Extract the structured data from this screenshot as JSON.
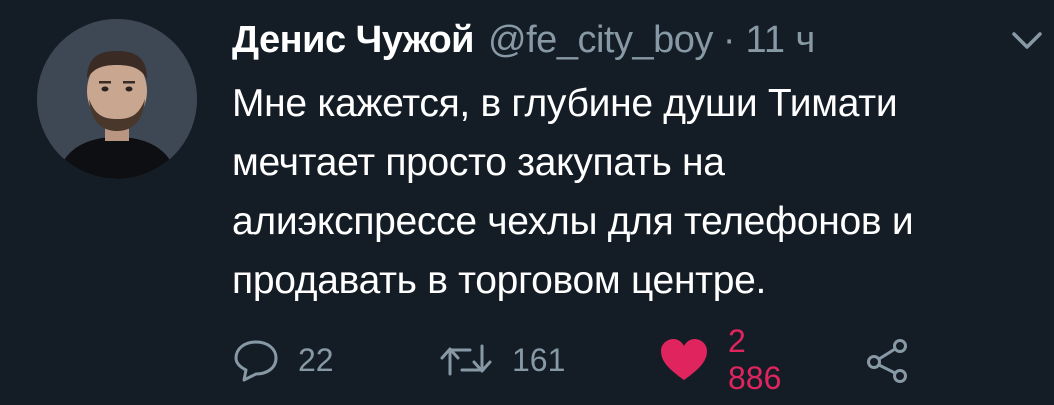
{
  "user": {
    "name": "Денис Чужой",
    "handle": "@fe_city_boy",
    "separator": "·",
    "time": "11 ч"
  },
  "tweet": {
    "lines": [
      "Мне кажется, в глубине души Тимати",
      "мечтает просто закупать на",
      "алиэкспрессе чехлы для телефонов и",
      "продавать в торговом центре."
    ]
  },
  "actions": {
    "reply": {
      "icon": "reply-icon",
      "count": "22"
    },
    "retweet": {
      "icon": "retweet-icon",
      "count": "161"
    },
    "like": {
      "icon": "heart-icon",
      "count": "2 886",
      "liked": true
    },
    "share": {
      "icon": "share-icon"
    }
  },
  "colors": {
    "background": "#141d26",
    "text": "#ffffff",
    "muted": "#8899a6",
    "like": "#e0245e"
  }
}
